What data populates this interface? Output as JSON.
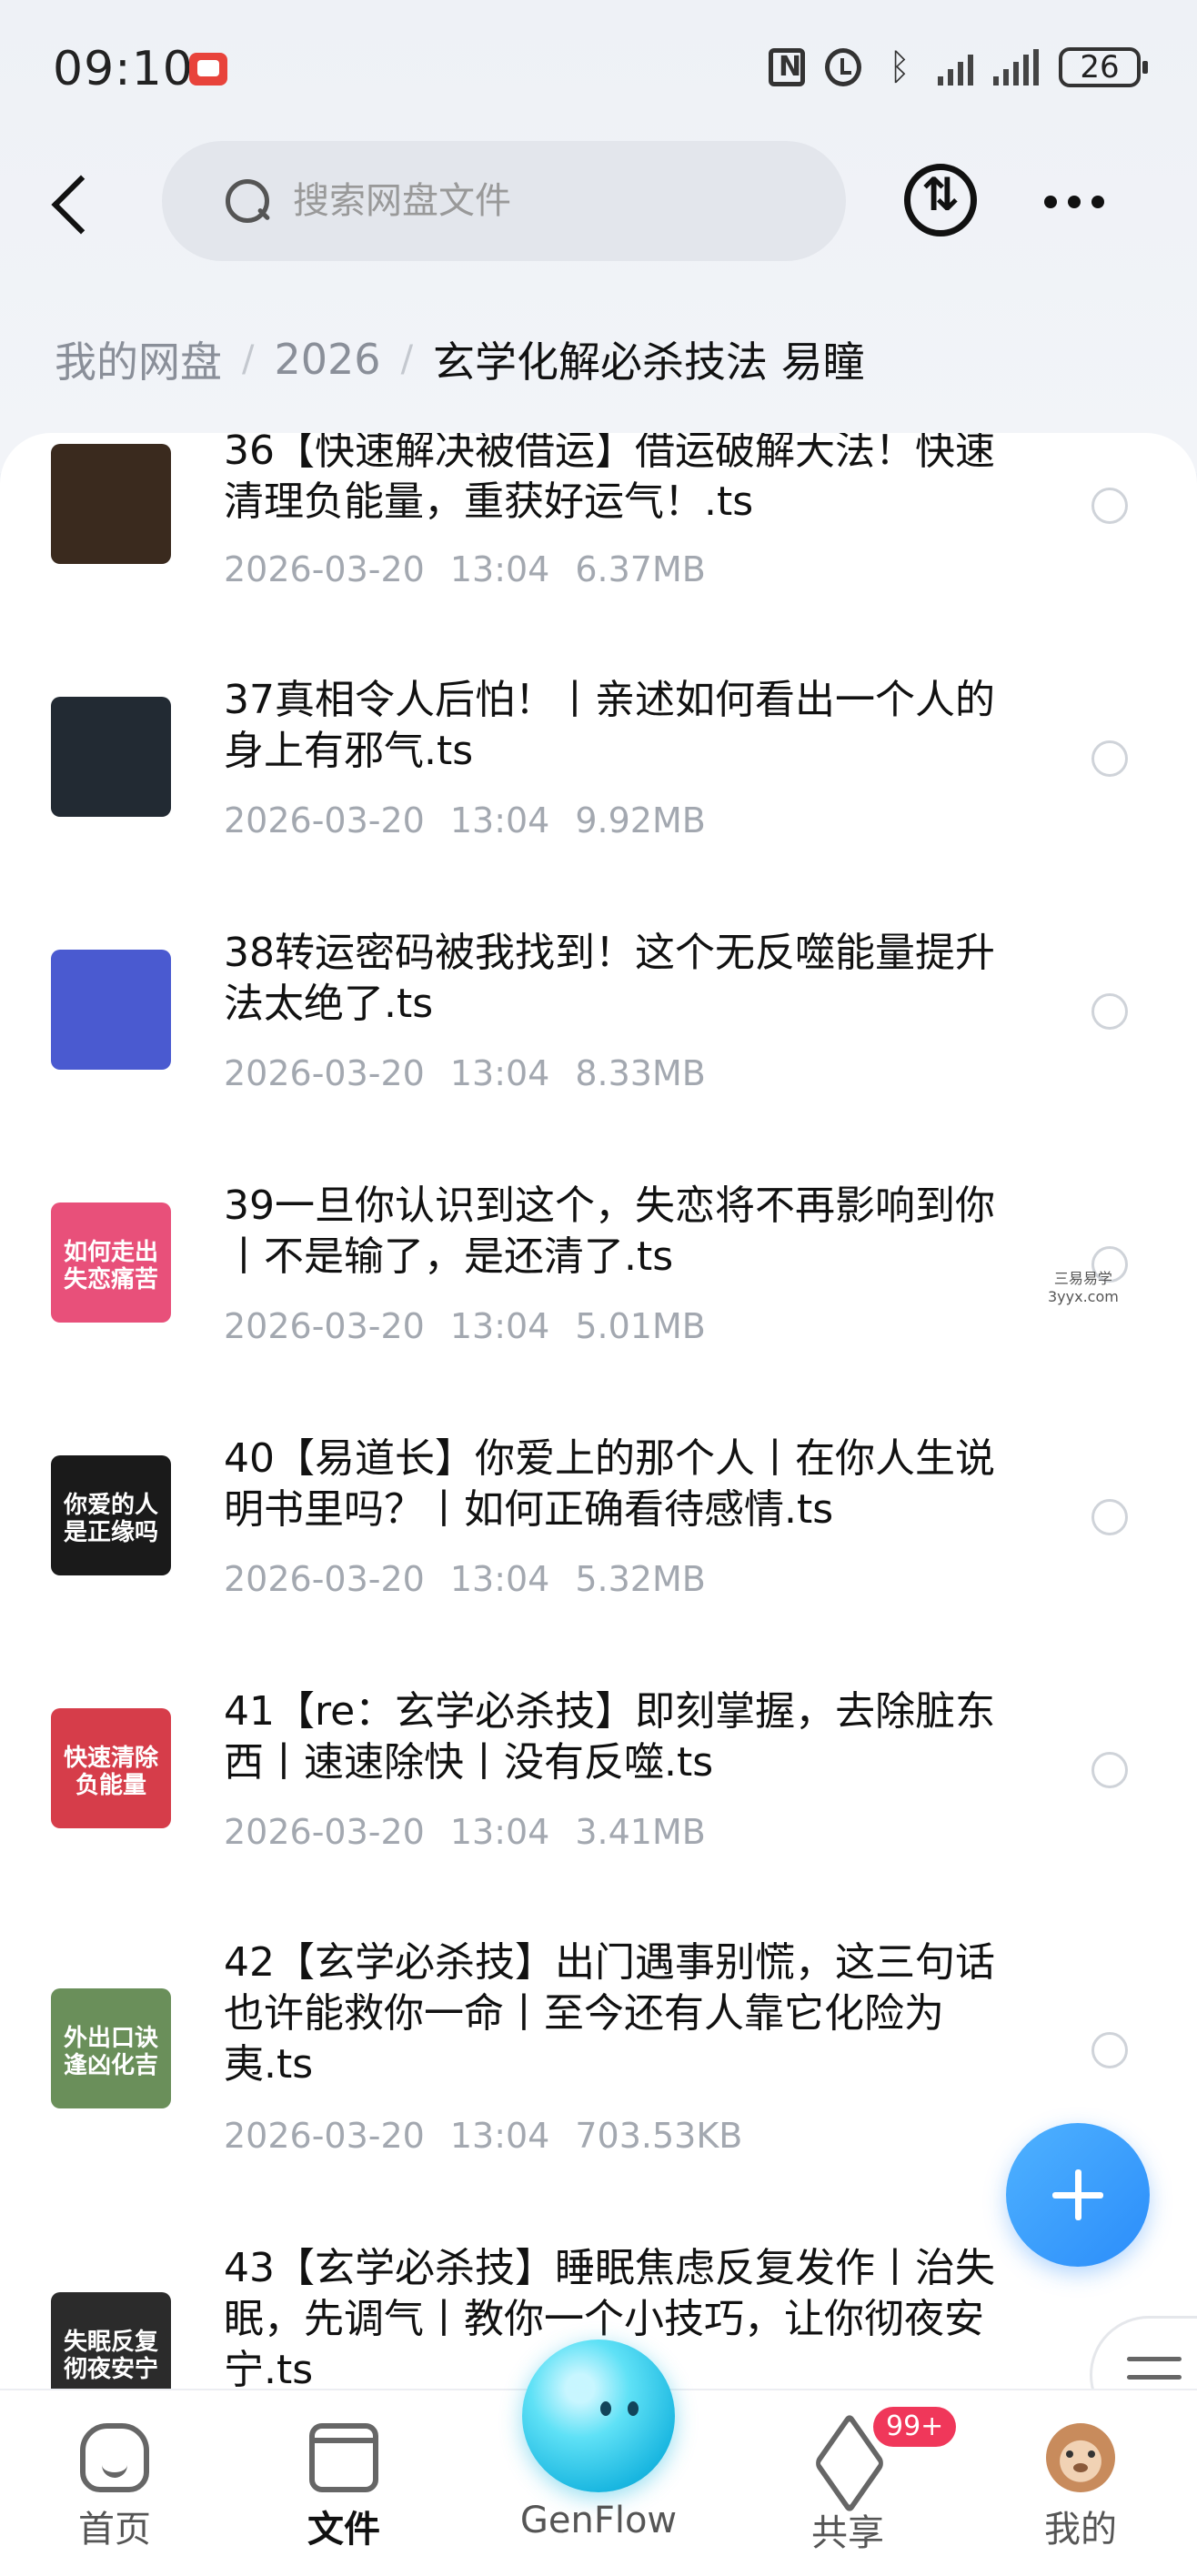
{
  "status_bar": {
    "time": "09:10",
    "battery": "26",
    "icons": [
      "recording-icon",
      "nfc-icon",
      "alarm-icon",
      "bluetooth-icon",
      "signal-icon",
      "signal-4g-icon",
      "battery-icon"
    ]
  },
  "header": {
    "search_placeholder": "搜索网盘文件",
    "icons": [
      "back-icon",
      "search-icon",
      "transfer-icon",
      "more-icon"
    ]
  },
  "breadcrumb": [
    {
      "label": "我的网盘"
    },
    {
      "label": "2026"
    },
    {
      "label": "玄学化解必杀技法 易瞳"
    }
  ],
  "files": [
    {
      "name": "36【快速解决被借运】借运破解大法！快速清理负能量，重获好运气！.ts",
      "date": "2026-03-20",
      "time": "13:04",
      "size": "6.37MB",
      "thumb_text": "",
      "thumb_color": "#3a2a1e"
    },
    {
      "name": "37真相令人后怕！丨亲述如何看出一个人的身上有邪气.ts",
      "date": "2026-03-20",
      "time": "13:04",
      "size": "9.92MB",
      "thumb_text": "",
      "thumb_color": "#222a33"
    },
    {
      "name": "38转运密码被我找到！这个无反噬能量提升法太绝了.ts",
      "date": "2026-03-20",
      "time": "13:04",
      "size": "8.33MB",
      "thumb_text": "",
      "thumb_color": "#4a5ad0"
    },
    {
      "name": "39一旦你认识到这个，失恋将不再影响到你丨不是输了，是还清了.ts",
      "date": "2026-03-20",
      "time": "13:04",
      "size": "5.01MB",
      "thumb_text": "如何走出失恋痛苦",
      "thumb_color": "#e8507a"
    },
    {
      "name": "40【易道长】你爱上的那个人丨在你人生说明书里吗？丨如何正确看待感情.ts",
      "date": "2026-03-20",
      "time": "13:04",
      "size": "5.32MB",
      "thumb_text": "你爱的人是正缘吗",
      "thumb_color": "#1a1a1a"
    },
    {
      "name": "41【re：玄学必杀技】即刻掌握，去除脏东西丨速速除快丨没有反噬.ts",
      "date": "2026-03-20",
      "time": "13:04",
      "size": "3.41MB",
      "thumb_text": "快速清除负能量",
      "thumb_color": "#d63d4a"
    },
    {
      "name": "42【玄学必杀技】出门遇事别慌，这三句话也许能救你一命丨至今还有人靠它化险为夷.ts",
      "date": "2026-03-20",
      "time": "13:04",
      "size": "703.53KB",
      "thumb_text": "外出口诀逢凶化吉",
      "thumb_color": "#6a8f5a"
    },
    {
      "name": "43【玄学必杀技】睡眠焦虑反复发作丨治失眠，先调气丨教你一个小技巧，让你彻夜安宁.ts",
      "date": "",
      "time": "",
      "size": "",
      "thumb_text": "失眠反复彻夜安宁",
      "thumb_color": "#2b2b2b"
    }
  ],
  "watermark": {
    "line1": "三易易学",
    "line2": "3yyx.com"
  },
  "bottom_nav": [
    {
      "label": "首页"
    },
    {
      "label": "文件"
    },
    {
      "label": "GenFlow"
    },
    {
      "label": "共享"
    },
    {
      "label": "我的"
    }
  ],
  "share_badge": "99+",
  "colors": {
    "accent": "#2b8dfa",
    "badge": "#f0375a",
    "muted": "#a3a8b0"
  }
}
